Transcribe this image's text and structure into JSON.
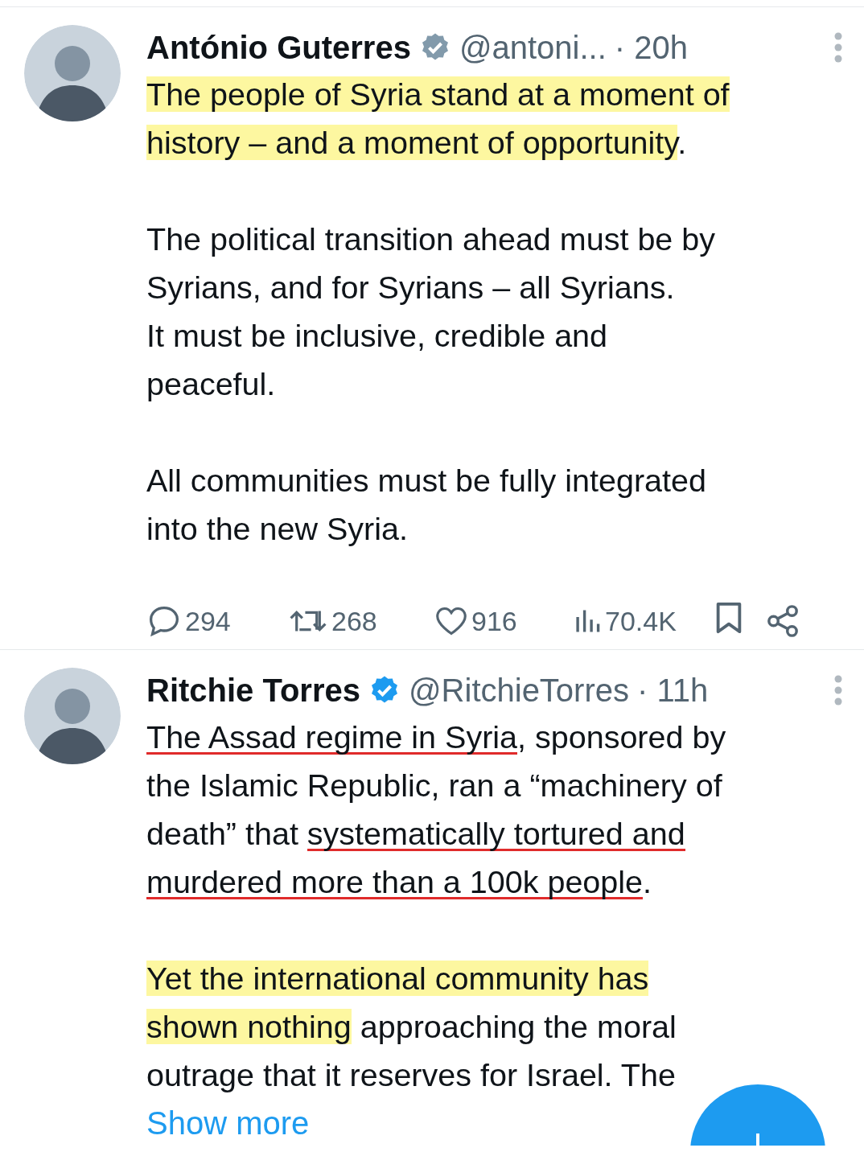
{
  "tweets": [
    {
      "name": "António Guterres",
      "badge": {
        "color": "#829aab"
      },
      "handle": "@antoni...",
      "time": "· 20h",
      "paragraphs": [
        {
          "lines": [
            {
              "segments": [
                {
                  "text": "The people of Syria stand at a moment of",
                  "highlighted": true,
                  "underlined": false
                }
              ]
            },
            {
              "segments": [
                {
                  "text": "history – and a moment of opportunity",
                  "highlighted": true,
                  "underlined": false
                },
                {
                  "text": ".",
                  "highlighted": false,
                  "underlined": false
                }
              ]
            }
          ]
        },
        {
          "lines": [
            {
              "segments": [
                {
                  "text": "The political transition ahead must be by",
                  "highlighted": false,
                  "underlined": false
                }
              ]
            },
            {
              "segments": [
                {
                  "text": "Syrians, and for Syrians – all Syrians.",
                  "highlighted": false,
                  "underlined": false
                }
              ]
            },
            {
              "segments": [
                {
                  "text": "It must be inclusive, credible and",
                  "highlighted": false,
                  "underlined": false
                }
              ]
            },
            {
              "segments": [
                {
                  "text": "peaceful.",
                  "highlighted": false,
                  "underlined": false
                }
              ]
            }
          ]
        },
        {
          "lines": [
            {
              "segments": [
                {
                  "text": "All communities must be fully integrated",
                  "highlighted": false,
                  "underlined": false
                }
              ]
            },
            {
              "segments": [
                {
                  "text": "into the new Syria.",
                  "highlighted": false,
                  "underlined": false
                }
              ]
            }
          ]
        }
      ],
      "actions": {
        "replies": "294",
        "reposts": "268",
        "likes": "916",
        "views": "70.4K"
      }
    },
    {
      "name": "Ritchie Torres",
      "badge": {
        "color": "#1d9bf0"
      },
      "handle": "@RitchieTorres",
      "time": "· 11h",
      "paragraphs": [
        {
          "lines": [
            {
              "segments": [
                {
                  "text": "The Assad regime in Syria",
                  "highlighted": false,
                  "underlined": true
                },
                {
                  "text": ", sponsored by",
                  "highlighted": false,
                  "underlined": false
                }
              ]
            },
            {
              "segments": [
                {
                  "text": "the Islamic Republic, ran a “machinery of",
                  "highlighted": false,
                  "underlined": false
                }
              ]
            },
            {
              "segments": [
                {
                  "text": "death” that ",
                  "highlighted": false,
                  "underlined": false
                },
                {
                  "text": "systematically tortured and",
                  "highlighted": false,
                  "underlined": true
                }
              ]
            },
            {
              "segments": [
                {
                  "text": "murdered more than a 100k people",
                  "highlighted": false,
                  "underlined": true
                },
                {
                  "text": ".",
                  "highlighted": false,
                  "underlined": false
                }
              ]
            }
          ]
        },
        {
          "lines": [
            {
              "segments": [
                {
                  "text": "Yet the international community has",
                  "highlighted": true,
                  "underlined": false
                }
              ]
            },
            {
              "segments": [
                {
                  "text": "shown nothing",
                  "highlighted": true,
                  "underlined": false
                },
                {
                  "text": " approaching the moral",
                  "highlighted": false,
                  "underlined": false
                }
              ]
            },
            {
              "segments": [
                {
                  "text": "outrage that it reserves for Israel.  The",
                  "highlighted": false,
                  "underlined": false
                }
              ]
            }
          ]
        }
      ],
      "show_more": "Show more"
    }
  ]
}
